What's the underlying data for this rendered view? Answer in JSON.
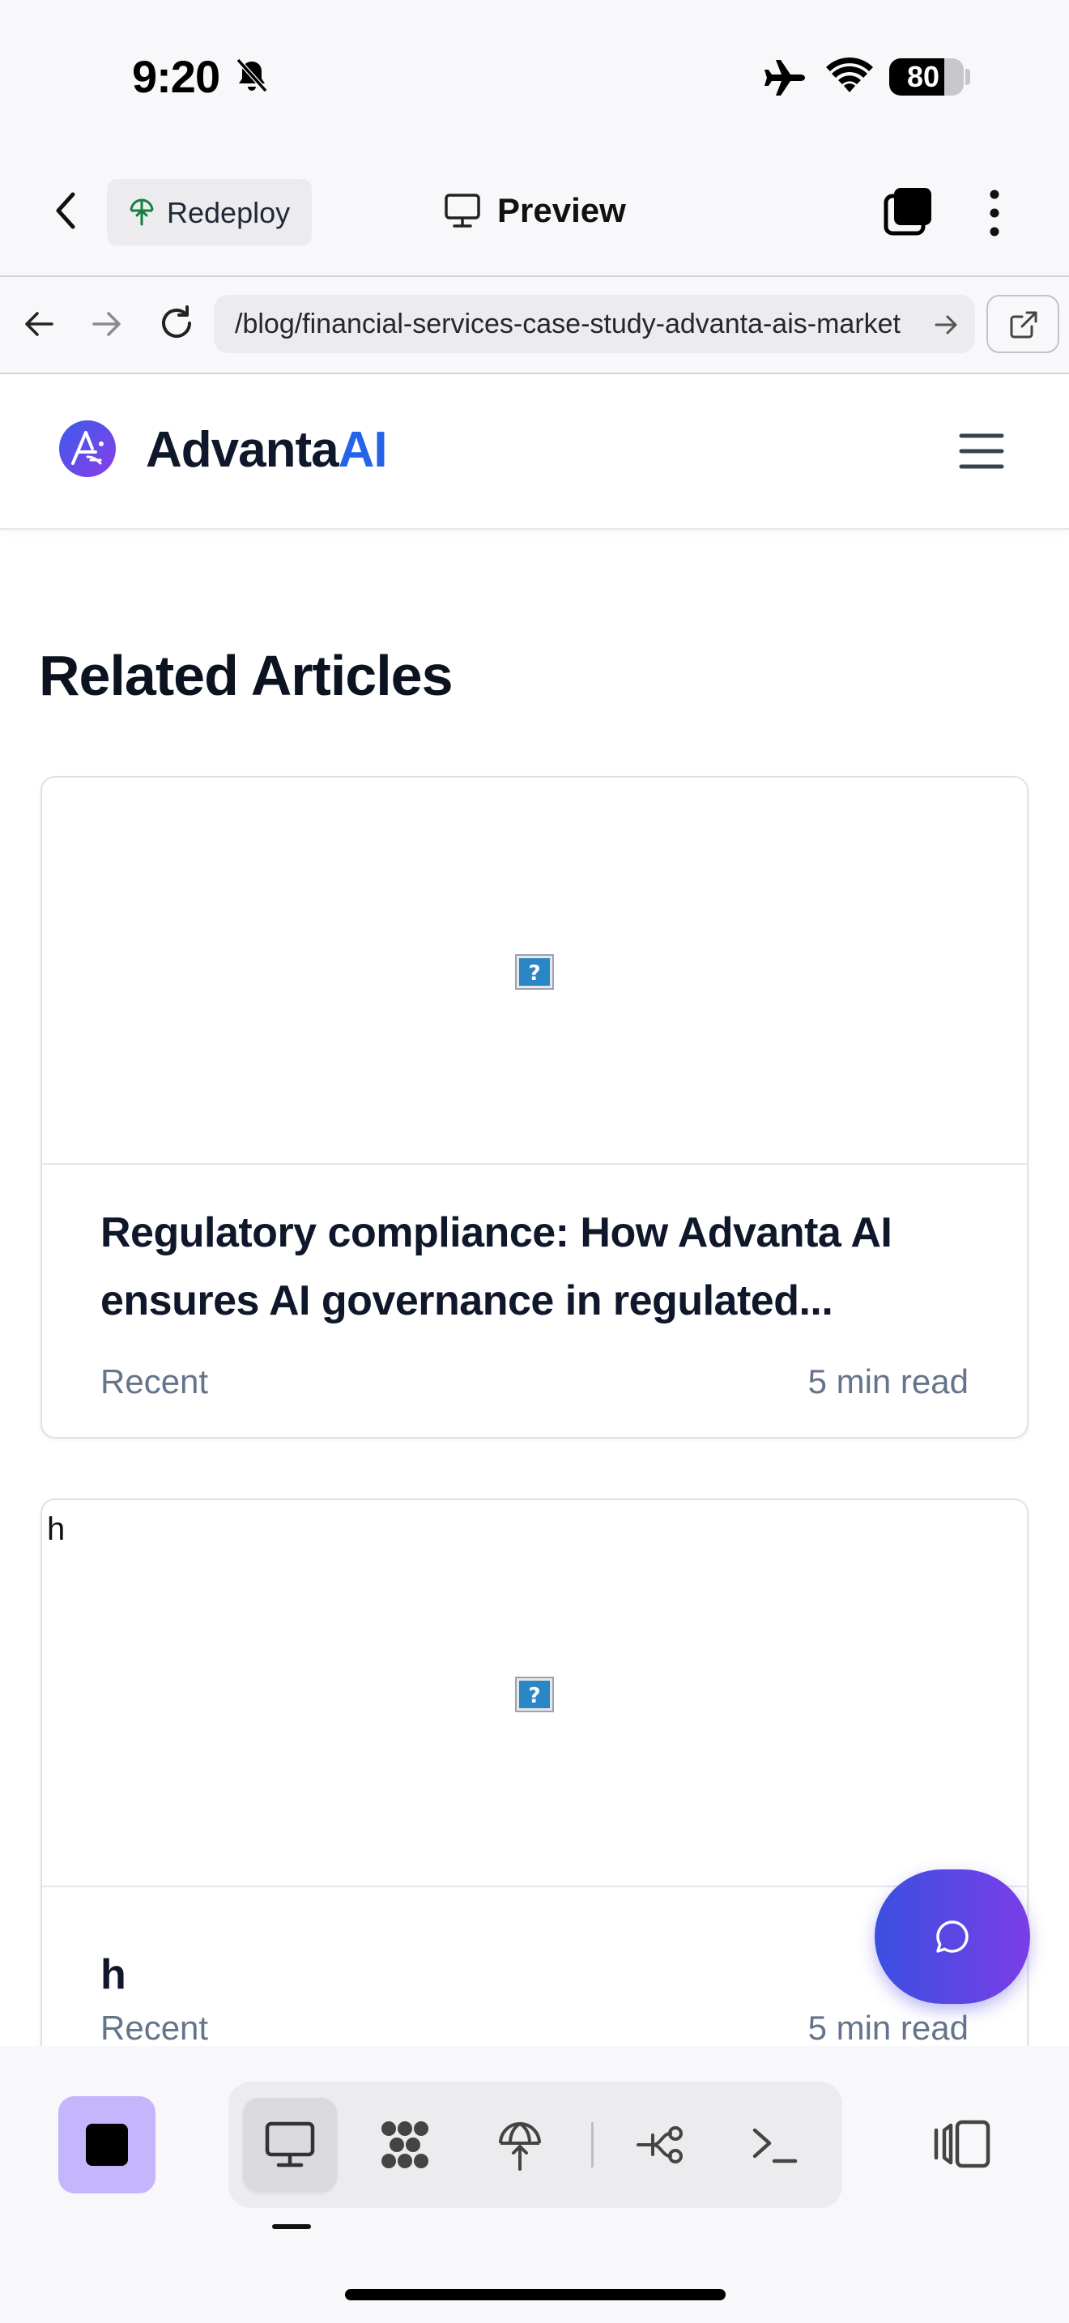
{
  "status_bar": {
    "time": "9:20",
    "battery_percent": 80,
    "battery_label": "80"
  },
  "toolbar": {
    "redeploy_label": "Redeploy",
    "preview_label": "Preview"
  },
  "browser": {
    "url": "/blog/financial-services-case-study-advanta-ais-market"
  },
  "site": {
    "brand_primary": "Advanta",
    "brand_accent": "AI",
    "brand_accent_color": "#2563eb"
  },
  "main": {
    "section_title": "Related Articles",
    "articles": [
      {
        "image_alt": "",
        "title": "Regulatory compliance: How Advanta AI ensures AI governance in regulated...",
        "category": "Recent",
        "read_time": "5 min read"
      },
      {
        "image_alt": "h",
        "title": "h",
        "category": "Recent",
        "read_time": "5 min read"
      }
    ]
  },
  "icons": {
    "status": [
      "bell-slash-icon",
      "airplane-icon",
      "wifi-icon",
      "battery-icon"
    ],
    "toolbar": [
      "back-chevron-icon",
      "redeploy-icon",
      "monitor-icon",
      "tabs-icon",
      "more-vertical-icon"
    ],
    "browser": [
      "arrow-left-icon",
      "arrow-right-icon",
      "reload-icon",
      "arrow-right-small-icon",
      "external-link-icon"
    ],
    "dock": [
      "stop-icon",
      "monitor-icon",
      "dots-grid-icon",
      "deploy-icon",
      "git-branch-icon",
      "terminal-icon",
      "layout-icon"
    ]
  },
  "colors": {
    "accent_purple": "#c4b5fd",
    "fab_gradient_start": "#3b4fe0",
    "fab_gradient_end": "#7a3ee8"
  }
}
